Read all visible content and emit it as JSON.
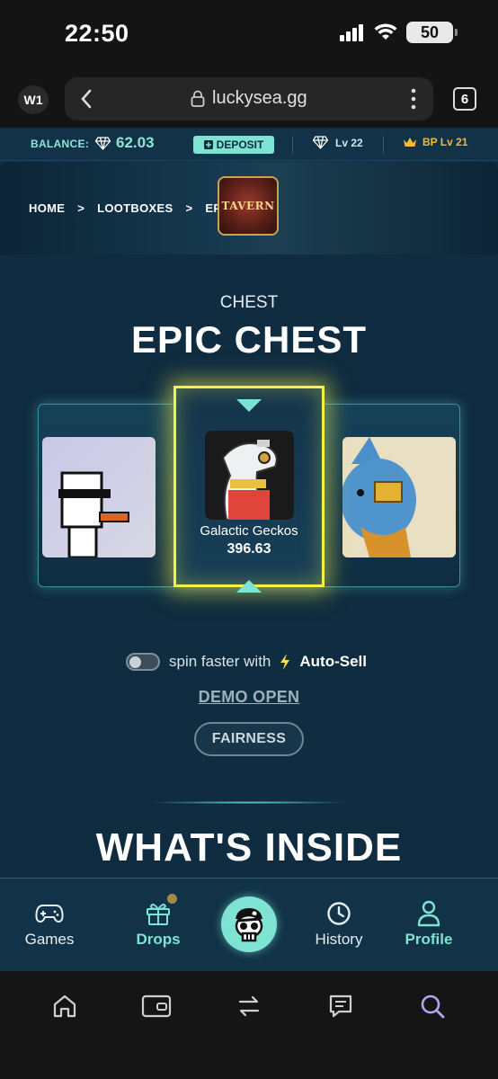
{
  "status": {
    "time": "22:50",
    "battery": "50"
  },
  "browser": {
    "window_badge": "W1",
    "url": "luckysea.gg",
    "tab_count": "6"
  },
  "topbar": {
    "balance_label": "BALANCE:",
    "balance_value": "62.03",
    "deposit_label": "DEPOSIT",
    "level": "Lv 22",
    "bp_level": "BP Lv 21"
  },
  "breadcrumb": [
    "HOME",
    ">",
    "LOOTBOXES",
    ">",
    "EPIC"
  ],
  "hero_logo": "TAVERN",
  "chest": {
    "category": "CHEST",
    "title": "EPIC CHEST"
  },
  "winner": {
    "name": "Galactic Geckos",
    "price": "396.63"
  },
  "autosell": {
    "text": "spin faster with",
    "label": "Auto-Sell"
  },
  "demo_label": "DEMO OPEN",
  "fairness_label": "FAIRNESS",
  "section_title": "WHAT'S INSIDE",
  "nav": {
    "games": "Games",
    "drops": "Drops",
    "history": "History",
    "profile": "Profile"
  },
  "colors": {
    "accent": "#7fe3d4",
    "highlight": "#f3f04a",
    "background": "#0f2c40",
    "bp_gold": "#f2b93a"
  }
}
